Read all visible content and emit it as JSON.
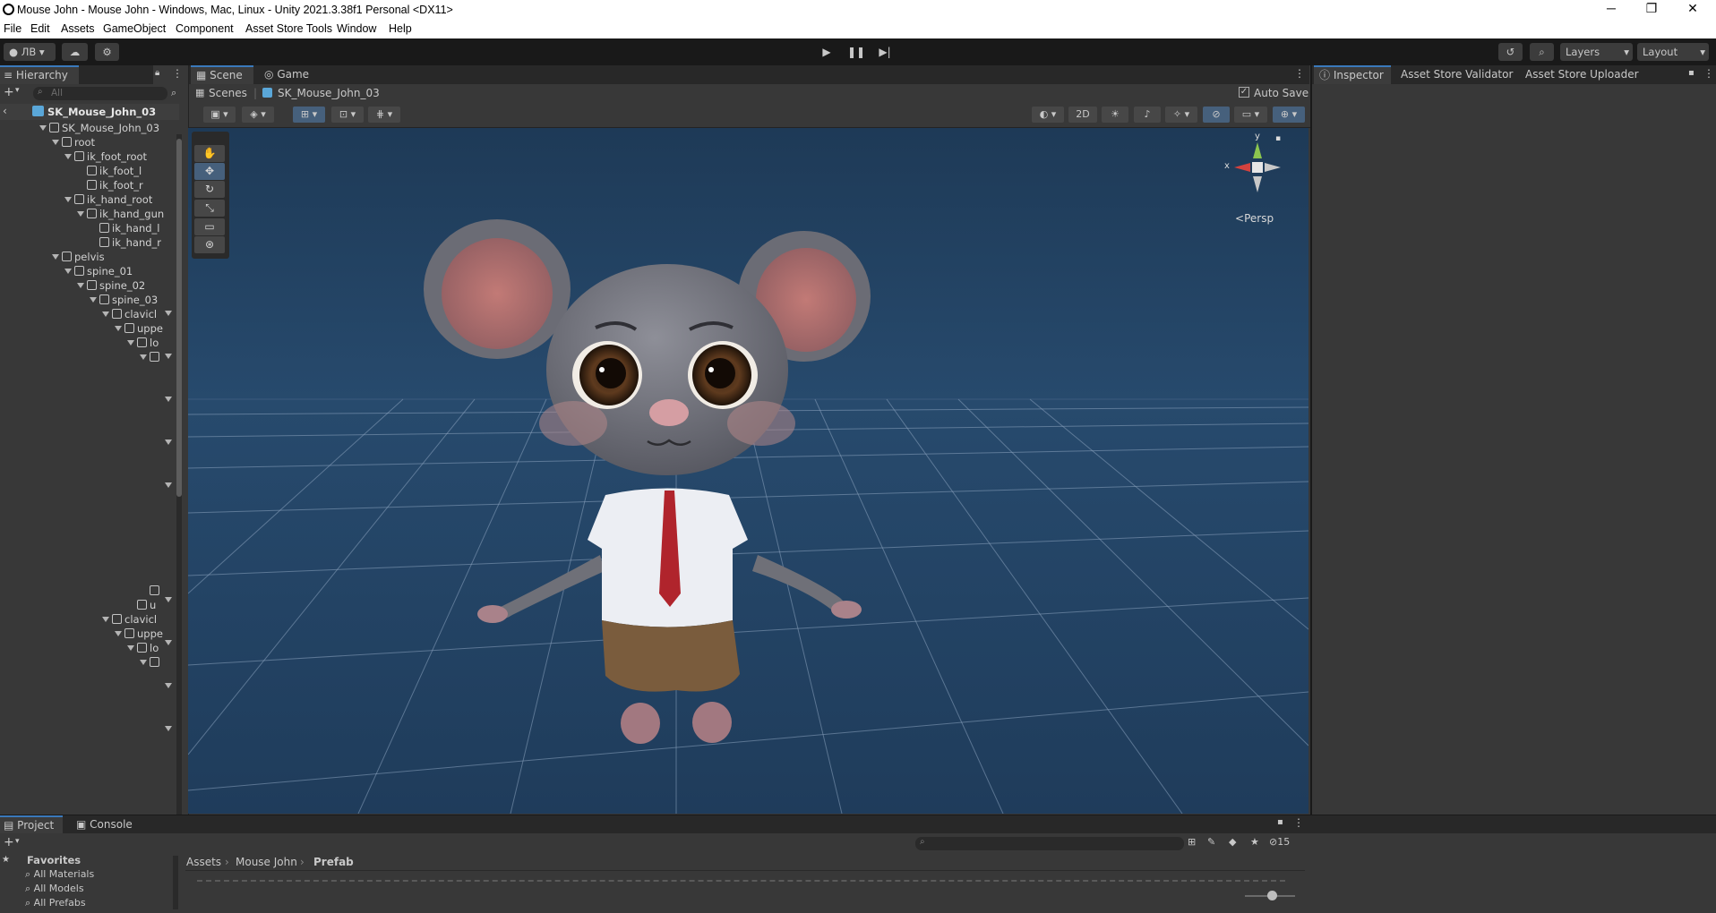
{
  "window": {
    "title": "Mouse John - Mouse John - Windows, Mac, Linux - Unity 2021.3.38f1 Personal <DX11>",
    "minimize": "─",
    "maximize": "❐",
    "close": "✕"
  },
  "menu": [
    "File",
    "Edit",
    "Assets",
    "GameObject",
    "Component",
    "Asset Store Tools",
    "Window",
    "Help"
  ],
  "toolbar": {
    "account": "ЛВ",
    "layers": "Layers",
    "layout": "Layout"
  },
  "hierarchy": {
    "tab": "Hierarchy",
    "search_placeholder": "All",
    "scene_root": "SK_Mouse_John_03",
    "rows": [
      {
        "label": "SK_Mouse_John_03",
        "indent": 0,
        "expand": true
      },
      {
        "label": "root",
        "indent": 1,
        "expand": true
      },
      {
        "label": "ik_foot_root",
        "indent": 2,
        "expand": true
      },
      {
        "label": "ik_foot_l",
        "indent": 3,
        "expand": false
      },
      {
        "label": "ik_foot_r",
        "indent": 3,
        "expand": false
      },
      {
        "label": "ik_hand_root",
        "indent": 2,
        "expand": true
      },
      {
        "label": "ik_hand_gun",
        "indent": 3,
        "expand": true
      },
      {
        "label": "ik_hand_l",
        "indent": 4,
        "expand": false
      },
      {
        "label": "ik_hand_r",
        "indent": 4,
        "expand": false
      },
      {
        "label": "pelvis",
        "indent": 1,
        "expand": true
      },
      {
        "label": "spine_01",
        "indent": 2,
        "expand": true
      },
      {
        "label": "spine_02",
        "indent": 3,
        "expand": true
      },
      {
        "label": "spine_03",
        "indent": 4,
        "expand": true
      },
      {
        "label": "clavicl",
        "indent": 5,
        "expand": true
      },
      {
        "label": "uppe",
        "indent": 6,
        "expand": true
      },
      {
        "label": "lo",
        "indent": 7,
        "expand": true
      },
      {
        "label": "",
        "indent": 8,
        "expand": true
      }
    ],
    "rows2": [
      {
        "label": "",
        "indent": 8,
        "expand": false
      },
      {
        "label": "u",
        "indent": 7,
        "expand": false
      },
      {
        "label": "clavicl",
        "indent": 5,
        "expand": true
      },
      {
        "label": "uppe",
        "indent": 6,
        "expand": true
      },
      {
        "label": "lo",
        "indent": 7,
        "expand": true
      },
      {
        "label": "",
        "indent": 8,
        "expand": true
      }
    ]
  },
  "scene": {
    "tabs": [
      "Scene",
      "Game"
    ],
    "breadcrumb": [
      "Scenes",
      "SK_Mouse_John_03"
    ],
    "auto_save": "Auto Save",
    "mode_2d": "2D",
    "persp": "Persp",
    "axis_x": "x",
    "axis_y": "y"
  },
  "inspector": {
    "tabs": [
      "Inspector",
      "Asset Store Validator",
      "Asset Store Uploader"
    ]
  },
  "project": {
    "tabs": [
      "Project",
      "Console"
    ],
    "favorites": "Favorites",
    "fav_items": [
      "All Materials",
      "All Models",
      "All Prefabs"
    ],
    "path": [
      "Assets",
      "Mouse John",
      "Prefab"
    ],
    "hidden_count": "15"
  },
  "colors": {
    "accent": "#3a79bb",
    "viewport": "#1f3b59"
  }
}
